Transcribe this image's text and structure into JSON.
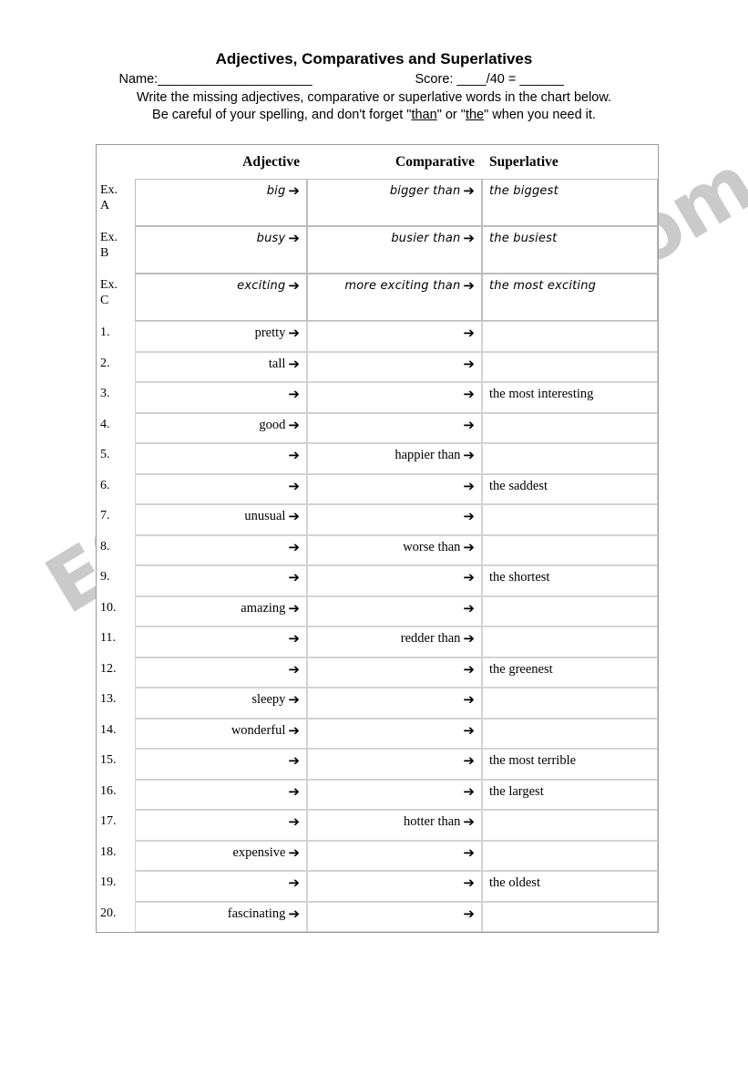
{
  "header": {
    "title": "Adjectives, Comparatives and Superlatives",
    "name_label": "Name:_____________________",
    "score_label": "Score: ____/40 = ______",
    "instruction_line_1": "Write the missing adjectives, comparative or superlative words in the chart below.",
    "instruction_line_2_a": "Be careful of your spelling, and don't forget \"",
    "instruction_than": "than",
    "instruction_line_2_b": "\" or \"",
    "instruction_the": "the",
    "instruction_line_2_c": "\" when you need it."
  },
  "watermark": {
    "text": "ESLprintables.com",
    "color": "#c8c8c8"
  },
  "table": {
    "columns": {
      "number": "",
      "adjective": "Adjective",
      "comparative": "Comparative",
      "superlative": "Superlative"
    },
    "arrow_glyph": "➔",
    "header_bg": "#cccccc",
    "example_bg": "#cccccc",
    "border_color": "#9a9a9a",
    "example_rows": [
      {
        "number": "Ex.\nA",
        "adjective": "big",
        "adjective_arrow": true,
        "comparative": "bigger than",
        "comparative_arrow": true,
        "superlative": "the biggest"
      },
      {
        "number": "Ex.\nB",
        "adjective": "busy",
        "adjective_arrow": true,
        "comparative": "busier than",
        "comparative_arrow": true,
        "superlative": "the busiest"
      },
      {
        "number": "Ex.\nC",
        "adjective": "exciting",
        "adjective_arrow": true,
        "comparative": "more exciting than",
        "comparative_arrow": true,
        "superlative": "the most exciting"
      }
    ],
    "rows": [
      {
        "number": "1.",
        "adjective": "pretty",
        "adjective_arrow": true,
        "comparative": "",
        "comparative_arrow": true,
        "superlative": ""
      },
      {
        "number": "2.",
        "adjective": "tall",
        "adjective_arrow": true,
        "comparative": "",
        "comparative_arrow": true,
        "superlative": ""
      },
      {
        "number": "3.",
        "adjective": "",
        "adjective_arrow": true,
        "comparative": "",
        "comparative_arrow": true,
        "superlative": "the most interesting"
      },
      {
        "number": "4.",
        "adjective": "good",
        "adjective_arrow": true,
        "comparative": "",
        "comparative_arrow": true,
        "superlative": ""
      },
      {
        "number": "5.",
        "adjective": "",
        "adjective_arrow": true,
        "comparative": "happier than",
        "comparative_arrow": true,
        "superlative": ""
      },
      {
        "number": "6.",
        "adjective": "",
        "adjective_arrow": true,
        "comparative": "",
        "comparative_arrow": true,
        "superlative": "the saddest"
      },
      {
        "number": "7.",
        "adjective": "unusual",
        "adjective_arrow": true,
        "comparative": "",
        "comparative_arrow": true,
        "superlative": ""
      },
      {
        "number": "8.",
        "adjective": "",
        "adjective_arrow": true,
        "comparative": "worse than",
        "comparative_arrow": true,
        "superlative": ""
      },
      {
        "number": "9.",
        "adjective": "",
        "adjective_arrow": true,
        "comparative": "",
        "comparative_arrow": true,
        "superlative": "the shortest"
      },
      {
        "number": "10.",
        "adjective": "amazing",
        "adjective_arrow": true,
        "comparative": "",
        "comparative_arrow": true,
        "superlative": ""
      },
      {
        "number": "11.",
        "adjective": "",
        "adjective_arrow": true,
        "comparative": "redder than",
        "comparative_arrow": true,
        "superlative": ""
      },
      {
        "number": "12.",
        "adjective": "",
        "adjective_arrow": true,
        "comparative": "",
        "comparative_arrow": true,
        "superlative": "the greenest"
      },
      {
        "number": "13.",
        "adjective": "sleepy",
        "adjective_arrow": true,
        "comparative": "",
        "comparative_arrow": true,
        "superlative": ""
      },
      {
        "number": "14.",
        "adjective": "wonderful",
        "adjective_arrow": true,
        "comparative": "",
        "comparative_arrow": true,
        "superlative": ""
      },
      {
        "number": "15.",
        "adjective": "",
        "adjective_arrow": true,
        "comparative": "",
        "comparative_arrow": true,
        "superlative": " the most terrible"
      },
      {
        "number": "16.",
        "adjective": "",
        "adjective_arrow": true,
        "comparative": "",
        "comparative_arrow": true,
        "superlative": "the largest"
      },
      {
        "number": "17.",
        "adjective": "",
        "adjective_arrow": true,
        "comparative": "hotter than",
        "comparative_arrow": true,
        "superlative": ""
      },
      {
        "number": "18.",
        "adjective": "expensive",
        "adjective_arrow": true,
        "comparative": "",
        "comparative_arrow": true,
        "superlative": ""
      },
      {
        "number": "19.",
        "adjective": "",
        "adjective_arrow": true,
        "comparative": "",
        "comparative_arrow": true,
        "superlative": "the oldest"
      },
      {
        "number": "20.",
        "adjective": "fascinating",
        "adjective_arrow": true,
        "comparative": "",
        "comparative_arrow": true,
        "superlative": ""
      }
    ]
  }
}
